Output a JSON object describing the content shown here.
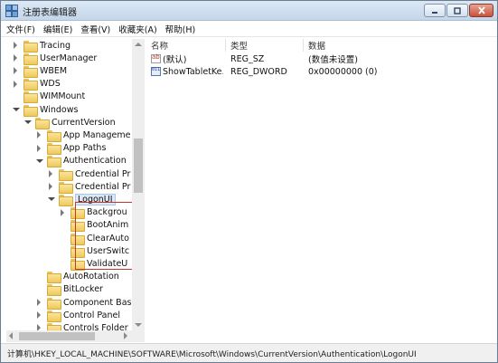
{
  "window": {
    "title": "注册表编辑器"
  },
  "menu": [
    "文件(F)",
    "编辑(E)",
    "查看(V)",
    "收藏夹(A)",
    "帮助(H)"
  ],
  "tree": [
    {
      "label": "Tracing",
      "level": 1,
      "state": "collapsed"
    },
    {
      "label": "UserManager",
      "level": 1,
      "state": "collapsed"
    },
    {
      "label": "WBEM",
      "level": 1,
      "state": "collapsed"
    },
    {
      "label": "WDS",
      "level": 1,
      "state": "collapsed"
    },
    {
      "label": "WIMMount",
      "level": 1,
      "state": "none"
    },
    {
      "label": "Windows",
      "level": 1,
      "state": "expanded"
    },
    {
      "label": "CurrentVersion",
      "level": 2,
      "state": "expanded"
    },
    {
      "label": "App Manageme",
      "level": 3,
      "state": "collapsed"
    },
    {
      "label": "App Paths",
      "level": 3,
      "state": "collapsed"
    },
    {
      "label": "Authentication",
      "level": 3,
      "state": "expanded"
    },
    {
      "label": "Credential Pr",
      "level": 4,
      "state": "collapsed"
    },
    {
      "label": "Credential Pr",
      "level": 4,
      "state": "collapsed"
    },
    {
      "label": "LogonUI",
      "level": 4,
      "state": "expanded",
      "selected": true
    },
    {
      "label": "Backgrou",
      "level": 5,
      "state": "collapsed"
    },
    {
      "label": "BootAnim",
      "level": 5,
      "state": "none"
    },
    {
      "label": "ClearAuto",
      "level": 5,
      "state": "none"
    },
    {
      "label": "UserSwitc",
      "level": 5,
      "state": "none"
    },
    {
      "label": "ValidateU",
      "level": 5,
      "state": "none"
    },
    {
      "label": "AutoRotation",
      "level": 3,
      "state": "none"
    },
    {
      "label": "BitLocker",
      "level": 3,
      "state": "none"
    },
    {
      "label": "Component Base",
      "level": 3,
      "state": "collapsed"
    },
    {
      "label": "Control Panel",
      "level": 3,
      "state": "collapsed"
    },
    {
      "label": "Controls Folder",
      "level": 3,
      "state": "collapsed"
    }
  ],
  "columns": {
    "name": "名称",
    "type": "类型",
    "data": "数据"
  },
  "values": [
    {
      "icon": "string-value-icon",
      "kind": "sz",
      "name": "(默认)",
      "type": "REG_SZ",
      "data": "(数值未设置)"
    },
    {
      "icon": "dword-value-icon",
      "kind": "dw",
      "name": "ShowTabletKe...",
      "type": "REG_DWORD",
      "data": "0x00000000 (0)"
    }
  ],
  "statusbar": {
    "path": "计算机\\HKEY_LOCAL_MACHINE\\SOFTWARE\\Microsoft\\Windows\\CurrentVersion\\Authentication\\LogonUI"
  }
}
